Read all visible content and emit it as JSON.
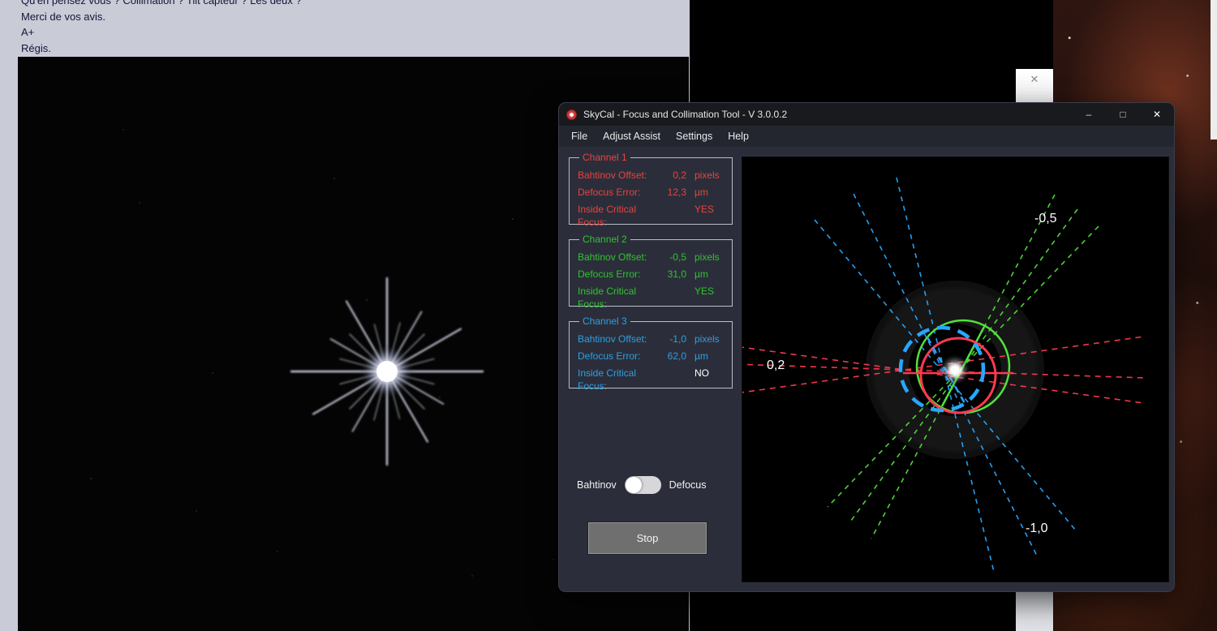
{
  "background": {
    "forum_lines": [
      "Qu'en pensez vous ? Collimation ? Tilt capteur ? Les deux ?",
      "Merci de vos avis.",
      "A+",
      "Régis."
    ],
    "overlay_close_icon": "✕"
  },
  "app": {
    "title": "SkyCal - Focus and Collimation Tool - V 3.0.0.2",
    "titlebar_icons": {
      "minimize": "–",
      "maximize": "□",
      "close": "✕"
    },
    "menu": [
      {
        "label": "File"
      },
      {
        "label": "Adjust Assist"
      },
      {
        "label": "Settings"
      },
      {
        "label": "Help"
      }
    ],
    "channels": [
      {
        "name": "Channel 1",
        "color": "#e8433c",
        "rows": [
          {
            "label": "Bahtinov Offset:",
            "value": "0,2",
            "unit": "pixels"
          },
          {
            "label": "Defocus Error:",
            "value": "12,3",
            "unit": "µm"
          },
          {
            "label": "Inside Critical Focus:",
            "value": "YES",
            "unit": ""
          }
        ]
      },
      {
        "name": "Channel 2",
        "color": "#2fc32f",
        "rows": [
          {
            "label": "Bahtinov Offset:",
            "value": "-0,5",
            "unit": "pixels"
          },
          {
            "label": "Defocus Error:",
            "value": "31,0",
            "unit": "µm"
          },
          {
            "label": "Inside Critical Focus:",
            "value": "YES",
            "unit": ""
          }
        ]
      },
      {
        "name": "Channel 3",
        "color": "#2d9fe4",
        "rows": [
          {
            "label": "Bahtinov Offset:",
            "value": "-1,0",
            "unit": "pixels"
          },
          {
            "label": "Defocus Error:",
            "value": "62,0",
            "unit": "µm"
          },
          {
            "label": "Inside Critical Focus:",
            "value": "NO",
            "unit": "",
            "value_color": "#ffffff"
          }
        ]
      }
    ],
    "toggle": {
      "left_label": "Bahtinov",
      "right_label": "Defocus"
    },
    "stop_button": "Stop",
    "viz": {
      "labels": [
        {
          "text": "-0,5"
        },
        {
          "text": "0,2"
        },
        {
          "text": "-1,0"
        }
      ],
      "colors": {
        "channel1": "#ff3950",
        "channel2": "#52e03a",
        "channel3": "#27a7ff"
      }
    }
  }
}
